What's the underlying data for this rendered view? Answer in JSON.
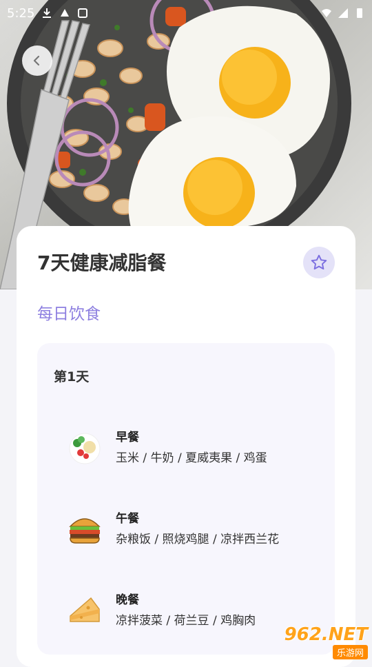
{
  "status_bar": {
    "time": "5:25"
  },
  "header": {
    "title": "7天健康减脂餐",
    "subtitle": "每日饮食"
  },
  "day": {
    "label": "第1天",
    "meals": [
      {
        "name": "早餐",
        "items": "玉米 / 牛奶 / 夏威夷果 / 鸡蛋",
        "icon": "salad-plate-icon"
      },
      {
        "name": "午餐",
        "items": "杂粮饭 / 照烧鸡腿 / 凉拌西兰花",
        "icon": "burger-icon"
      },
      {
        "name": "晚餐",
        "items": "凉拌菠菜 / 荷兰豆 / 鸡胸肉",
        "icon": "cheese-icon"
      }
    ]
  },
  "watermark": {
    "brand": "962.NET",
    "site": "乐游网"
  },
  "colors": {
    "accent": "#8d7fe0",
    "star_bg": "#e4e2f8",
    "card_bg": "#ffffff",
    "day_bg": "#f7f6fd"
  }
}
